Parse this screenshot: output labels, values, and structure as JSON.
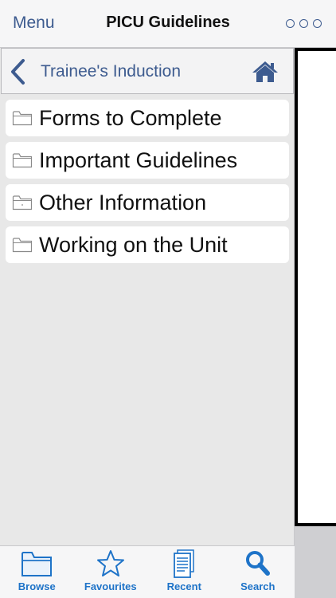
{
  "navbar": {
    "menu_label": "Menu",
    "title": "PICU Guidelines",
    "more_icon": "ellipsis-circles-icon"
  },
  "breadcrumb": {
    "label": "Trainee's Induction",
    "back_icon": "chevron-left-icon",
    "home_icon": "home-icon"
  },
  "folders": [
    {
      "label": "Forms to Complete",
      "icon": "folder-icon"
    },
    {
      "label": "Important Guidelines",
      "icon": "folder-icon"
    },
    {
      "label": "Other Information",
      "icon": "folder-icon"
    },
    {
      "label": "Working on the Unit",
      "icon": "folder-icon"
    }
  ],
  "tabs": [
    {
      "label": "Browse",
      "icon": "folder-icon"
    },
    {
      "label": "Favourites",
      "icon": "star-icon"
    },
    {
      "label": "Recent",
      "icon": "document-icon"
    },
    {
      "label": "Search",
      "icon": "search-icon"
    }
  ],
  "colors": {
    "accent": "#3d5b8f",
    "tab_accent": "#1e73c8"
  }
}
